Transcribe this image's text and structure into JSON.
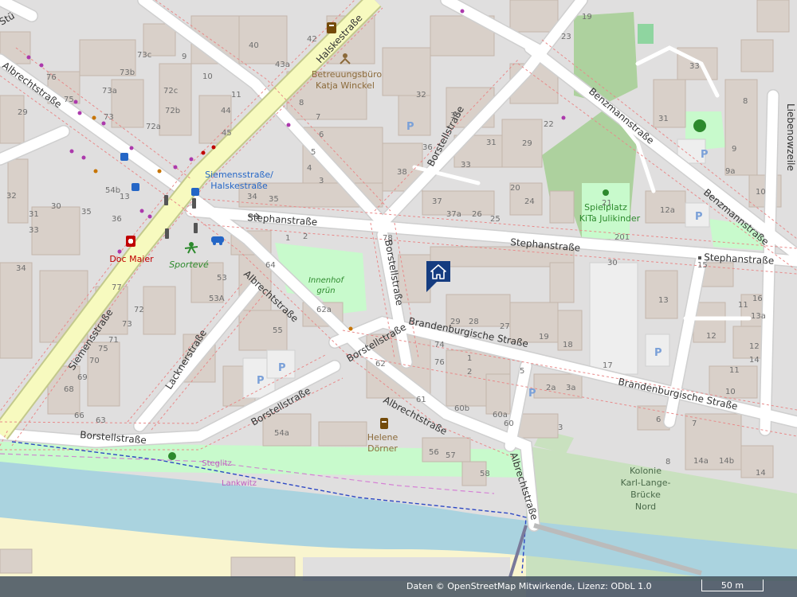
{
  "map": {
    "streets": {
      "albrecht": "Albrechtstraße",
      "halske": "Halskestraße",
      "siemens": "Siemensstraße",
      "stephan": "Stephanstraße",
      "borstell": "Borstellstraße",
      "brandenburg": "Brandenburgische Straße",
      "benzmann": "Benzmannstraße",
      "lackner": "Lacknerstraße",
      "liebenow": "Liebenowzeile",
      "stu": "Stü"
    },
    "pois": {
      "betreuung_line1": "Betreuungsbüro",
      "betreuung_line2": "Katja Winckel",
      "stop_line1": "Siemensstraße/",
      "stop_line2": "Halskestraße",
      "doc": "Doc Maier",
      "sport": "Sportevé",
      "innenhof_line1": "Innenhof",
      "innenhof_line2": "grün",
      "spielplatz_line1": "Spielplatz",
      "spielplatz_line2": "KiTa Julikinder",
      "helene_line1": "Helene",
      "helene_line2": "Dörner",
      "kolonie_line1": "Kolonie",
      "kolonie_line2": "Karl-Lange-",
      "kolonie_line3": "Brücke",
      "kolonie_line4": "Nord",
      "steglitz": "Steglitz",
      "lankwitz": "Lankwitz"
    },
    "house_numbers": [
      "42",
      "43a",
      "40",
      "73c",
      "73b",
      "73a",
      "73",
      "75",
      "76",
      "72c",
      "72b",
      "72a",
      "9",
      "10",
      "11",
      "44",
      "45",
      "8",
      "7",
      "6",
      "5",
      "4",
      "3",
      "2",
      "1",
      "36",
      "32",
      "30",
      "29",
      "31",
      "33",
      "34",
      "35",
      "38",
      "37",
      "37a",
      "26",
      "25",
      "24",
      "20",
      "22",
      "23",
      "19",
      "21",
      "201",
      "27",
      "28",
      "29",
      "30",
      "31",
      "33",
      "8",
      "9",
      "9a",
      "10",
      "11",
      "12",
      "13",
      "13a",
      "14",
      "14a",
      "14b",
      "12a",
      "13",
      "36",
      "35",
      "34",
      "33",
      "32",
      "31",
      "30",
      "29",
      "54b",
      "54a",
      "53",
      "53A",
      "55",
      "56",
      "57",
      "58",
      "60",
      "60a",
      "60b",
      "61",
      "62",
      "62a",
      "63",
      "64",
      "66",
      "68",
      "69",
      "70",
      "71",
      "72",
      "73",
      "75",
      "77",
      "78",
      "74",
      "76",
      "1",
      "2",
      "2a",
      "3",
      "3a",
      "5",
      "6",
      "7",
      "8",
      "10",
      "11",
      "12",
      "14",
      "15",
      "16",
      "17",
      "18",
      "19",
      "20",
      "21",
      "22"
    ],
    "colors": {
      "land": "#f2efe9",
      "residential": "#e0dfdf",
      "building": "#d9d0c9",
      "building_stroke": "#c4b6ab",
      "primary_road": "#f7fabf",
      "primary_stroke": "#c3c98c",
      "park": "#c8facc",
      "forest_green": "#add19e",
      "allotment": "#c9e1bf",
      "water": "#aad3df",
      "sand": "#f9f5cf",
      "pedestrian_green": "#8fd5a0"
    }
  },
  "footer": {
    "attribution": "Daten © OpenStreetMap Mitwirkende, Lizenz: ODbL 1.0",
    "scale": "50 m"
  }
}
